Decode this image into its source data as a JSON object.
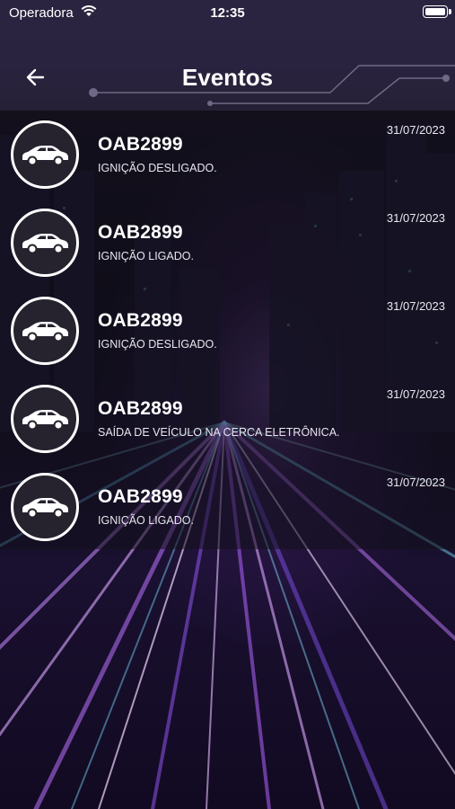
{
  "status_bar": {
    "carrier": "Operadora",
    "time": "12:35"
  },
  "header": {
    "title": "Eventos",
    "back_icon": "arrow-left-icon"
  },
  "events": [
    {
      "plate": "OAB2899",
      "description": "IGNIÇÃO DESLIGADO.",
      "date": "31/07/2023",
      "icon": "car-icon"
    },
    {
      "plate": "OAB2899",
      "description": "IGNIÇÃO LIGADO.",
      "date": "31/07/2023",
      "icon": "car-icon"
    },
    {
      "plate": "OAB2899",
      "description": "IGNIÇÃO DESLIGADO.",
      "date": "31/07/2023",
      "icon": "car-icon"
    },
    {
      "plate": "OAB2899",
      "description": "SAÍDA DE VEÍCULO NA CERCA ELETRÔNICA.",
      "date": "31/07/2023",
      "icon": "car-icon"
    },
    {
      "plate": "OAB2899",
      "description": "IGNIÇÃO LIGADO.",
      "date": "31/07/2023",
      "icon": "car-icon"
    }
  ],
  "colors": {
    "header_bg": "#2a2340",
    "list_overlay": "#12101c",
    "accent_purple": "#b36bff",
    "accent_cyan": "#6fe3ff"
  }
}
